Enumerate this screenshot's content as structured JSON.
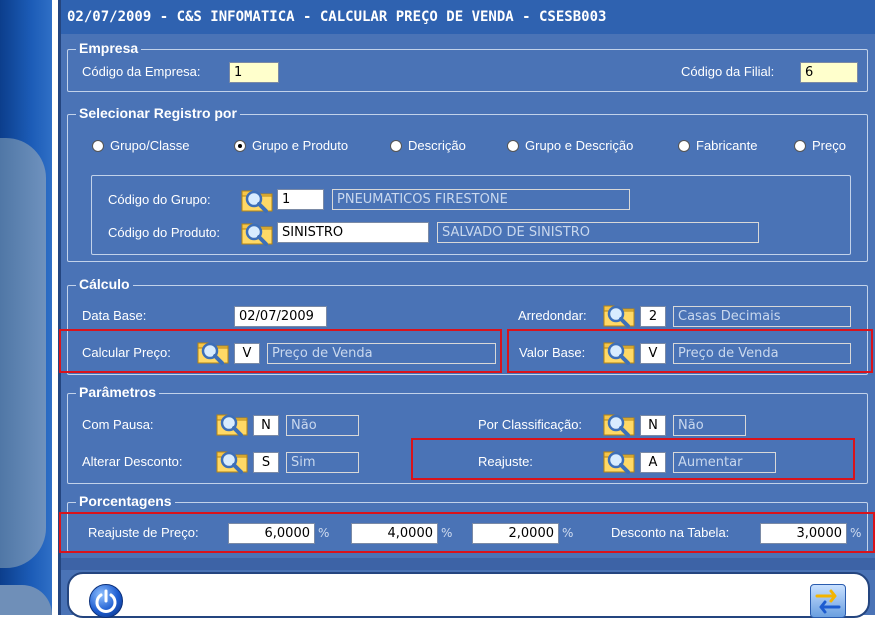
{
  "window": {
    "title": "02/07/2009 - C&S INFOMATICA - CALCULAR PREÇO DE VENDA - CSESB003"
  },
  "empresa": {
    "legend": "Empresa",
    "codigo_empresa_label": "Código da Empresa:",
    "codigo_empresa_value": "1",
    "codigo_filial_label": "Código da Filial:",
    "codigo_filial_value": "6"
  },
  "selecionar": {
    "legend": "Selecionar Registro por",
    "options": [
      {
        "label": "Grupo/Classe",
        "selected": false
      },
      {
        "label": "Grupo e Produto",
        "selected": true
      },
      {
        "label": "Descrição",
        "selected": false
      },
      {
        "label": "Grupo e Descrição",
        "selected": false
      },
      {
        "label": "Fabricante",
        "selected": false
      },
      {
        "label": "Preço",
        "selected": false
      }
    ],
    "codigo_grupo_label": "Código do Grupo:",
    "codigo_grupo_value": "1",
    "grupo_descricao": "PNEUMATICOS FIRESTONE",
    "codigo_produto_label": "Código do Produto:",
    "codigo_produto_value": "SINISTRO",
    "produto_descricao": "SALVADO DE SINISTRO"
  },
  "calculo": {
    "legend": "Cálculo",
    "data_base_label": "Data Base:",
    "data_base_value": "02/07/2009",
    "arredondar_label": "Arredondar:",
    "arredondar_code": "2",
    "arredondar_desc": "Casas Decimais",
    "calcular_preco_label": "Calcular Preço:",
    "calcular_preco_code": "V",
    "calcular_preco_desc": "Preço de Venda",
    "valor_base_label": "Valor Base:",
    "valor_base_code": "V",
    "valor_base_desc": "Preço de Venda"
  },
  "parametros": {
    "legend": "Parâmetros",
    "com_pausa_label": "Com Pausa:",
    "com_pausa_code": "N",
    "com_pausa_desc": "Não",
    "por_classificacao_label": "Por Classificação:",
    "por_classificacao_code": "N",
    "por_classificacao_desc": "Não",
    "alterar_desconto_label": "Alterar Desconto:",
    "alterar_desconto_code": "S",
    "alterar_desconto_desc": "Sim",
    "reajuste_label": "Reajuste:",
    "reajuste_code": "A",
    "reajuste_desc": "Aumentar"
  },
  "porcentagens": {
    "legend": "Porcentagens",
    "reajuste_preco_label": "Reajuste de Preço:",
    "reajuste_1": "6,0000",
    "reajuste_2": "4,0000",
    "reajuste_3": "2,0000",
    "percent_symbol": "%",
    "desconto_tabela_label": "Desconto na Tabela:",
    "desconto_tabela_value": "3,0000"
  },
  "icons": {
    "lookup": "folder-magnifier-icon",
    "power": "power-icon",
    "swap": "swap-arrows-icon"
  },
  "colors": {
    "window_bg": "#4a73b6",
    "title_bg": "#2f62b0",
    "highlight_box": "#d9131b",
    "yellow_field": "#ffffcc"
  }
}
